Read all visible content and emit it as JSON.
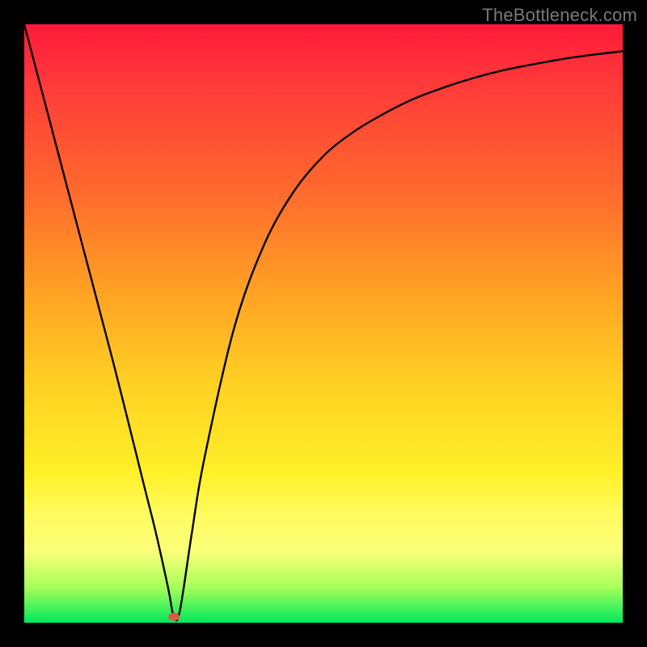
{
  "watermark": "TheBottleneck.com",
  "chart_data": {
    "type": "line",
    "title": "",
    "xlabel": "",
    "ylabel": "",
    "xlim": [
      0,
      100
    ],
    "ylim": [
      0,
      100
    ],
    "grid": false,
    "curve": {
      "x": [
        0,
        5,
        10,
        15,
        20,
        22,
        24,
        25,
        26,
        28,
        30,
        35,
        40,
        45,
        50,
        55,
        60,
        65,
        70,
        75,
        80,
        85,
        90,
        95,
        100
      ],
      "y": [
        100,
        81,
        62,
        43,
        23,
        15,
        6,
        1,
        2,
        15,
        27,
        49,
        63,
        72,
        78,
        82,
        85,
        87.5,
        89.4,
        91,
        92.3,
        93.3,
        94.2,
        94.9,
        95.5
      ]
    },
    "marker": {
      "x": 25,
      "y": 1,
      "color": "#d95a4a",
      "radius_px": 6
    }
  }
}
